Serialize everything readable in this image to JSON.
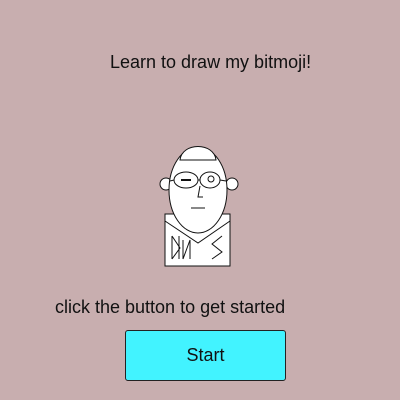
{
  "header": {
    "title": "Learn to draw my bitmoji!"
  },
  "main": {
    "hint": "click the button to get started",
    "start_label": "Start",
    "shirt_initials": "DS"
  },
  "colors": {
    "background": "#c8aeaf",
    "button": "#42f3ff",
    "stroke": "#111111",
    "fill": "#ffffff"
  }
}
